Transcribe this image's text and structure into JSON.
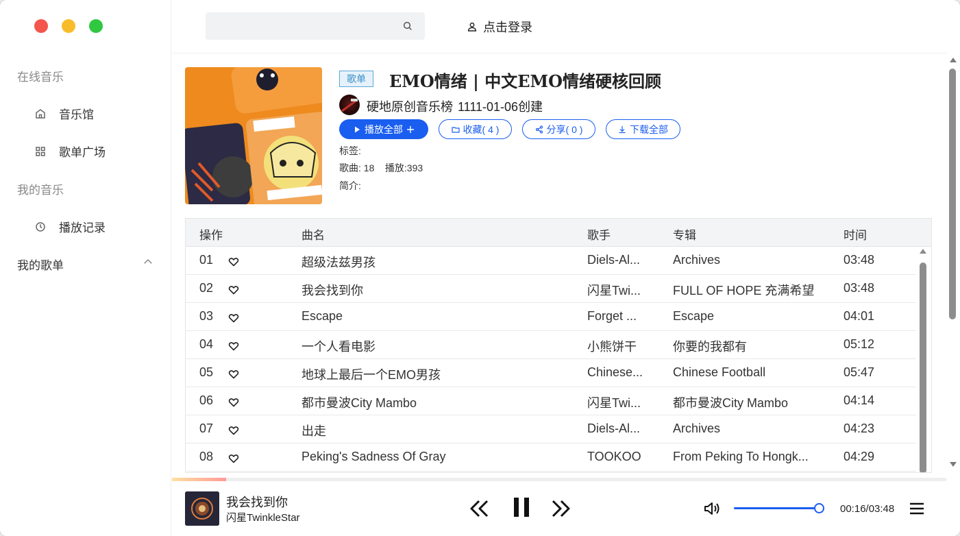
{
  "sidebar": {
    "section_online": "在线音乐",
    "item_music_hall": "音乐馆",
    "item_playlist_square": "歌单广场",
    "section_my_music": "我的音乐",
    "item_history": "播放记录",
    "section_my_playlists": "我的歌单"
  },
  "header": {
    "search_placeholder": "",
    "login_label": "点击登录"
  },
  "playlist": {
    "badge": "歌单",
    "title": "EMO情绪 | 中文EMO情绪硬核回顾",
    "creator": "硬地原创音乐榜",
    "created": "1111-01-06创建",
    "play_all": "播放全部",
    "collect": "收藏( 4 )",
    "share": "分享( 0 )",
    "download_all": "下载全部",
    "tags_label": "标签:",
    "stats": "歌曲: 18    播放:393",
    "intro_label": "简介:"
  },
  "table": {
    "columns": [
      "操作",
      "曲名",
      "歌手",
      "专辑",
      "时间"
    ],
    "rows": [
      {
        "no": "01",
        "title": "超级法兹男孩",
        "artist": "Diels-Al...",
        "album": "Archives",
        "time": "03:48"
      },
      {
        "no": "02",
        "title": "我会找到你",
        "artist": "闪星Twi...",
        "album": "FULL OF HOPE 充满希望",
        "time": "03:48"
      },
      {
        "no": "03",
        "title": "Escape",
        "artist": "Forget ...",
        "album": "Escape",
        "time": "04:01"
      },
      {
        "no": "04",
        "title": "一个人看电影",
        "artist": "小熊饼干",
        "album": "你要的我都有",
        "time": "05:12"
      },
      {
        "no": "05",
        "title": "地球上最后一个EMO男孩",
        "artist": "Chinese...",
        "album": "Chinese Football",
        "time": "05:47"
      },
      {
        "no": "06",
        "title": "都市曼波City Mambo",
        "artist": "闪星Twi...",
        "album": "都市曼波City Mambo",
        "time": "04:14"
      },
      {
        "no": "07",
        "title": "出走",
        "artist": "Diels-Al...",
        "album": "Archives",
        "time": "04:23"
      },
      {
        "no": "08",
        "title": "Peking's Sadness Of Gray",
        "artist": "TOOKOO",
        "album": "From Peking To Hongk...",
        "time": "04:29"
      }
    ]
  },
  "player": {
    "title": "我会找到你",
    "artist": "闪星TwinkleStar",
    "time": "00:16/03:48",
    "progress": 0.07,
    "volume": 1.0
  },
  "colors": {
    "accent": "#1a5ef0",
    "badge_border": "#5aa6d8"
  }
}
